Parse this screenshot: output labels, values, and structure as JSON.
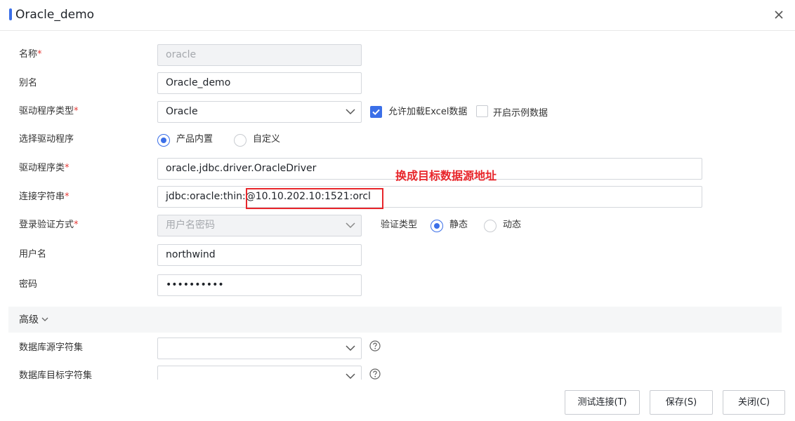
{
  "dialog": {
    "title": "Oracle_demo",
    "accent_color": "#3b6fe8",
    "close_icon": "close-icon"
  },
  "form": {
    "name": {
      "label": "名称",
      "required": "*",
      "value": "oracle"
    },
    "alias": {
      "label": "别名",
      "value": "Oracle_demo"
    },
    "driver_type": {
      "label": "驱动程序类型",
      "required": "*",
      "value": "Oracle",
      "allow_excel": {
        "label": "允许加载Excel数据",
        "checked": true
      },
      "sample_data": {
        "label": "开启示例数据",
        "checked": false
      }
    },
    "select_driver": {
      "label": "选择驱动程序",
      "options": [
        {
          "label": "产品内置",
          "selected": true
        },
        {
          "label": "自定义",
          "selected": false
        }
      ]
    },
    "driver_class": {
      "label": "驱动程序类",
      "required": "*",
      "value": "oracle.jdbc.driver.OracleDriver"
    },
    "connection_string": {
      "label": "连接字符串",
      "required": "*",
      "value": "jdbc:oracle:thin:@10.10.202.10:1521:orcl"
    },
    "auth_method": {
      "label": "登录验证方式",
      "required": "*",
      "value": "用户名密码",
      "verify_type": {
        "label": "验证类型",
        "options": [
          {
            "label": "静态",
            "selected": true
          },
          {
            "label": "动态",
            "selected": false
          }
        ]
      }
    },
    "username": {
      "label": "用户名",
      "value": "northwind"
    },
    "password": {
      "label": "密码",
      "value": "••••••••••"
    }
  },
  "annotation": {
    "text": "换成目标数据源地址",
    "color": "#e8262b"
  },
  "advanced": {
    "label": "高级",
    "source_charset": {
      "label": "数据库源字符集",
      "value": ""
    },
    "target_charset": {
      "label": "数据库目标字符集",
      "value": ""
    }
  },
  "buttons": {
    "test": "测试连接(T)",
    "save": "保存(S)",
    "close": "关闭(C)"
  }
}
